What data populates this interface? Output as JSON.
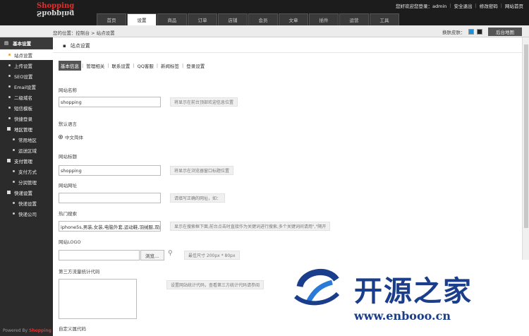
{
  "logo": {
    "top": "Shopping",
    "bottom": "Shopping"
  },
  "userbar": {
    "greeting": "您好欢迎您登录：admin",
    "links": [
      "安全退出",
      "修改密码",
      "网站首页"
    ]
  },
  "nav": {
    "tabs": [
      "首页",
      "设置",
      "商品",
      "订单",
      "店铺",
      "会员",
      "文章",
      "插件",
      "运营",
      "工具"
    ],
    "active_index": 1
  },
  "breadcrumb": "您的位置：控制台 > 站点设置",
  "skin": {
    "label": "换肤皮肤：",
    "colors": [
      "#1e90d6",
      "#222222"
    ]
  },
  "top_button": "后台地图",
  "sidebar": {
    "head": "基本设置",
    "items": [
      {
        "label": "站点设置",
        "active": true
      },
      {
        "label": "上传设置"
      },
      {
        "label": "SEO设置"
      },
      {
        "label": "Email设置"
      },
      {
        "label": "二级域名"
      },
      {
        "label": "短信模板"
      },
      {
        "label": "快捷登录"
      }
    ],
    "groups": [
      {
        "label": "地区管理",
        "subs": [
          "常用地区",
          "运送区域"
        ]
      },
      {
        "label": "支付管理",
        "subs": [
          "支付方式",
          "分润管理"
        ]
      },
      {
        "label": "快递设置",
        "subs": [
          "快递设置",
          "快递公司"
        ]
      }
    ]
  },
  "powered": {
    "prefix": "Powered By",
    "brand": "Shopping"
  },
  "section_title": "站点设置",
  "subtabs": [
    "基本信息",
    "管理相关",
    "联系设置",
    "QQ客服",
    "新闻标签",
    "登录设置"
  ],
  "form": {
    "site_name": {
      "label": "网站名称",
      "value": "shopping",
      "hint": "将显示在前台顶部欢迎信息位置"
    },
    "language": {
      "label": "默认语言",
      "option": "中文简体"
    },
    "site_title": {
      "label": "网站标题",
      "value": "shopping",
      "hint": "将显示在浏览器窗口标题位置"
    },
    "site_url": {
      "label": "网站网址",
      "value": "",
      "hint": "请填写正确的网址，如："
    },
    "hot_words": {
      "label": "热门搜索",
      "value": "iphone5s,男装,女装,电脑外套,运动鞋,羽绒服,双门",
      "hint": "显示在搜索框下面,前台点击时直接作为关键词进行搜索,多个关键词间请用\",\"隔开"
    },
    "logo": {
      "label": "网站LOGO",
      "browse": "浏览...",
      "hint": "最佳尺寸 200px * 80px"
    },
    "stats": {
      "label": "第三方流量统计代码",
      "hint": "设置网站统计代码，查看第三方统计代码请参阅"
    },
    "footer": {
      "label": "自定义属代码"
    }
  },
  "watermark": {
    "text": "开源之家",
    "url": "www.enbooo.cn"
  }
}
